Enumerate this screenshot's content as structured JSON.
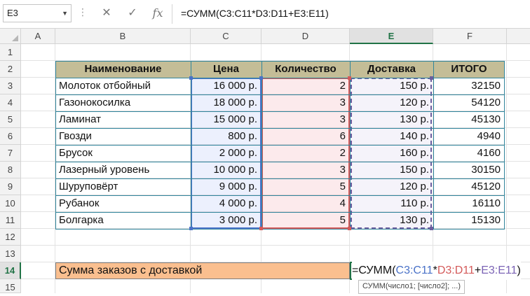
{
  "name_box": {
    "value": "E3"
  },
  "formula_bar": {
    "cancel_icon": "✕",
    "enter_icon": "✓",
    "fx_icon": "fx",
    "formula": "=СУММ(C3:C11*D3:D11+E3:E11)"
  },
  "columns": [
    "A",
    "B",
    "C",
    "D",
    "E",
    "F"
  ],
  "active_column": "E",
  "rows": [
    "1",
    "2",
    "3",
    "4",
    "5",
    "6",
    "7",
    "8",
    "9",
    "10",
    "11",
    "12",
    "13",
    "14",
    "15"
  ],
  "active_row": "14",
  "table": {
    "headers": [
      "Наименование",
      "Цена",
      "Количество",
      "Доставка",
      "ИТОГО"
    ],
    "rows": [
      [
        "Молоток отбойный",
        "16 000 р.",
        "2",
        "150 р.",
        "32150"
      ],
      [
        "Газонокосилка",
        "18 000 р.",
        "3",
        "120 р.",
        "54120"
      ],
      [
        "Ламинат",
        "15 000 р.",
        "3",
        "130 р.",
        "45130"
      ],
      [
        "Гвозди",
        "800 р.",
        "6",
        "140 р.",
        "4940"
      ],
      [
        "Брусок",
        "2 000 р.",
        "2",
        "160 р.",
        "4160"
      ],
      [
        "Лазерный уровень",
        "10 000 р.",
        "3",
        "150 р.",
        "30150"
      ],
      [
        "Шуруповёрт",
        "9 000 р.",
        "5",
        "120 р.",
        "45120"
      ],
      [
        "Рубанок",
        "4 000 р.",
        "4",
        "110 р.",
        "16110"
      ],
      [
        "Болгарка",
        "3 000 р.",
        "5",
        "130 р.",
        "15130"
      ]
    ]
  },
  "summary": {
    "label": "Сумма заказов с доставкой",
    "formula_parts": [
      "=СУММ(",
      "C3:C11",
      "*",
      "D3:D11",
      "+",
      "E3:E11",
      ")"
    ],
    "tooltip": "СУММ(число1; [число2]; ...)"
  },
  "colors": {
    "header_fill": "#c4bd97",
    "table_border": "#31859c",
    "summary_fill": "#fabf8f",
    "ref_blue": "#4a72c8",
    "ref_red": "#d45a5a",
    "ref_purple": "#7b63b5",
    "excel_green": "#217346"
  }
}
